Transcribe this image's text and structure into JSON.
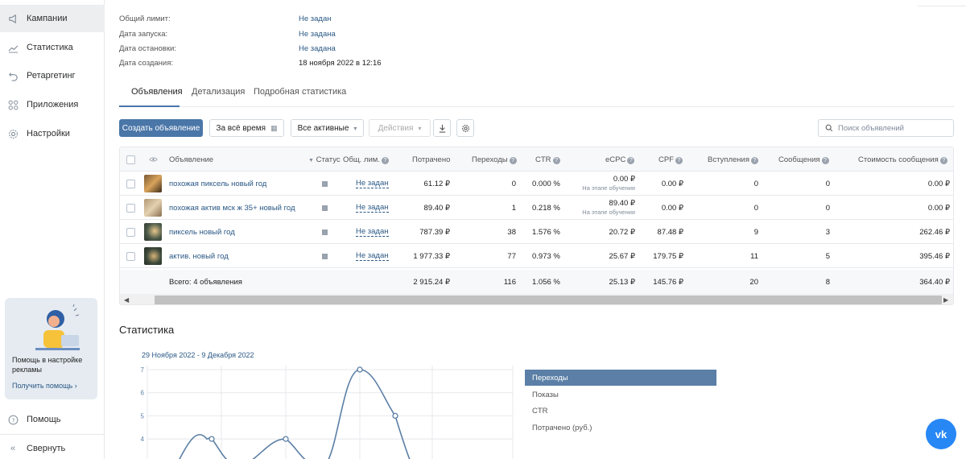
{
  "sidebar": {
    "items": [
      {
        "label": "Кампании",
        "icon": "megaphone-icon"
      },
      {
        "label": "Статистика",
        "icon": "chart-line-icon"
      },
      {
        "label": "Ретаргетинг",
        "icon": "retarget-icon"
      },
      {
        "label": "Приложения",
        "icon": "apps-icon"
      },
      {
        "label": "Настройки",
        "icon": "gear-icon"
      }
    ],
    "help_card": {
      "text": "Помощь в настройке рекламы",
      "link": "Получить помощь ›"
    },
    "help": "Помощь",
    "collapse": "Свернуть"
  },
  "info": {
    "rows": [
      {
        "label": "Общий лимит:",
        "value": "Не задан"
      },
      {
        "label": "Дата запуска:",
        "value": "Не задана"
      },
      {
        "label": "Дата остановки:",
        "value": "Не задана"
      },
      {
        "label": "Дата создания:",
        "value": "18 ноября 2022 в 12:16"
      }
    ]
  },
  "tabs": [
    "Объявления",
    "Детализация",
    "Подробная статистика"
  ],
  "toolbar": {
    "create": "Создать объявление",
    "period": "За всё время",
    "filter": "Все активные",
    "actions": "Действия",
    "search_placeholder": "Поиск объявлений"
  },
  "table": {
    "headers": {
      "ad": "Объявление",
      "status": "Статус",
      "limit": "Общ. лим.",
      "spent": "Потрачено",
      "clicks": "Переходы",
      "ctr": "CTR",
      "ecpc": "eCPC",
      "cpf": "CPF",
      "joins": "Вступления",
      "messages": "Сообщения",
      "msg_cost": "Стоимость сообщения"
    },
    "rows": [
      {
        "name": "похожая пиксель новый год",
        "limit": "Не задан",
        "spent": "61.12 ₽",
        "clicks": "0",
        "ctr": "0.000 %",
        "ecpc": "0.00 ₽",
        "ecpc_note": "На этапе обучения",
        "cpf": "0.00 ₽",
        "joins": "0",
        "messages": "0",
        "msg_cost": "0.00 ₽"
      },
      {
        "name": "похожая актив мск ж 35+ новый год",
        "limit": "Не задан",
        "spent": "89.40 ₽",
        "clicks": "1",
        "ctr": "0.218 %",
        "ecpc": "89.40 ₽",
        "ecpc_note": "На этапе обучения",
        "cpf": "0.00 ₽",
        "joins": "0",
        "messages": "0",
        "msg_cost": "0.00 ₽"
      },
      {
        "name": "пиксель новый год",
        "limit": "Не задан",
        "spent": "787.39 ₽",
        "clicks": "38",
        "ctr": "1.576 %",
        "ecpc": "20.72 ₽",
        "ecpc_note": "",
        "cpf": "87.48 ₽",
        "joins": "9",
        "messages": "3",
        "msg_cost": "262.46 ₽"
      },
      {
        "name": "актив. новый год",
        "limit": "Не задан",
        "spent": "1 977.33 ₽",
        "clicks": "77",
        "ctr": "0.973 %",
        "ecpc": "25.67 ₽",
        "ecpc_note": "",
        "cpf": "179.75 ₽",
        "joins": "11",
        "messages": "5",
        "msg_cost": "395.46 ₽"
      }
    ],
    "total": {
      "label": "Всего: 4 объявления",
      "spent": "2 915.24 ₽",
      "clicks": "116",
      "ctr": "1.056 %",
      "ecpc": "25.13 ₽",
      "cpf": "145.76 ₽",
      "joins": "20",
      "messages": "8",
      "msg_cost": "364.40 ₽"
    }
  },
  "stats": {
    "title": "Статистика",
    "date_range": "29 Ноября 2022 - 9 Декабря 2022",
    "legend": [
      "Переходы",
      "Показы",
      "CTR",
      "Потрачено (руб.)"
    ],
    "y_ticks": [
      "7",
      "6",
      "5",
      "4"
    ]
  },
  "chart_data": {
    "type": "line",
    "y_ticks": [
      4,
      5,
      6,
      7
    ],
    "ylim": [
      3,
      7
    ],
    "series": [
      {
        "name": "Переходы",
        "values": [
          4,
          4,
          7,
          5
        ]
      }
    ]
  },
  "colors": {
    "accent": "#4a76a8",
    "link": "#2a5885",
    "vk": "#2787f5"
  }
}
